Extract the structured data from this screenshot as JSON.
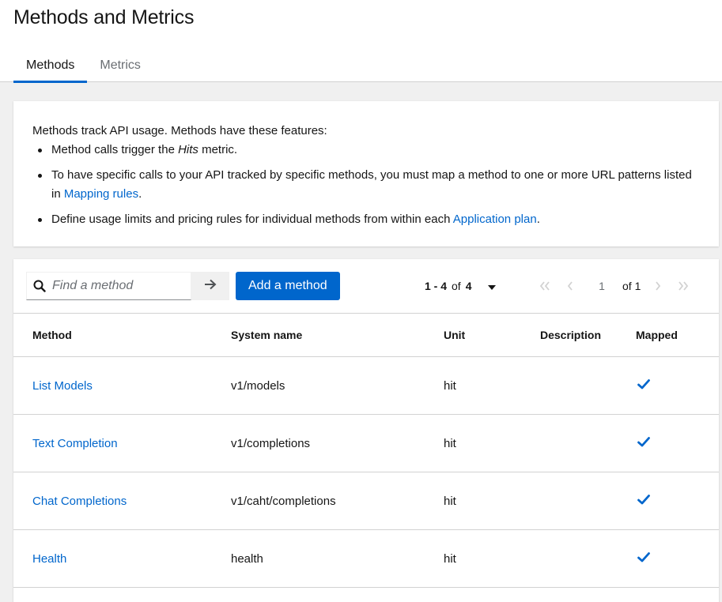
{
  "page": {
    "title": "Methods and Metrics",
    "tabs": [
      {
        "label": "Methods",
        "active": true
      },
      {
        "label": "Metrics",
        "active": false
      }
    ]
  },
  "info": {
    "intro": "Methods track API usage. Methods have these features:",
    "bullet1_pre": "Method calls trigger the ",
    "bullet1_em": "Hits",
    "bullet1_post": " metric.",
    "bullet2_pre": "To have specific calls to your API tracked by specific methods, you must map a method to one or more URL patterns listed in ",
    "bullet2_link": "Mapping rules",
    "bullet2_post": ".",
    "bullet3_pre": "Define usage limits and pricing rules for individual methods from within each ",
    "bullet3_link": "Application plan",
    "bullet3_post": "."
  },
  "toolbar": {
    "search_placeholder": "Find a method",
    "add_label": "Add a method",
    "range": "1 - 4",
    "of_word": "of",
    "total": "4",
    "current_page": "1",
    "of_pages": "of 1"
  },
  "table": {
    "headers": {
      "method": "Method",
      "system_name": "System name",
      "unit": "Unit",
      "description": "Description",
      "mapped": "Mapped"
    },
    "rows": [
      {
        "method": "List Models",
        "system_name": "v1/models",
        "unit": "hit",
        "description": "",
        "mapped": true
      },
      {
        "method": "Text Completion",
        "system_name": "v1/completions",
        "unit": "hit",
        "description": "",
        "mapped": true
      },
      {
        "method": "Chat Completions",
        "system_name": "v1/caht/completions",
        "unit": "hit",
        "description": "",
        "mapped": true
      },
      {
        "method": "Health",
        "system_name": "health",
        "unit": "hit",
        "description": "",
        "mapped": true
      }
    ]
  },
  "colors": {
    "accent": "#0066cc",
    "check": "#0066cc"
  },
  "icons": {
    "search": "search-icon",
    "arrow": "arrow-right-icon",
    "caret": "caret-down-icon",
    "first": "angle-double-left-icon",
    "prev": "angle-left-icon",
    "next": "angle-right-icon",
    "last": "angle-double-right-icon",
    "check": "check-icon"
  }
}
